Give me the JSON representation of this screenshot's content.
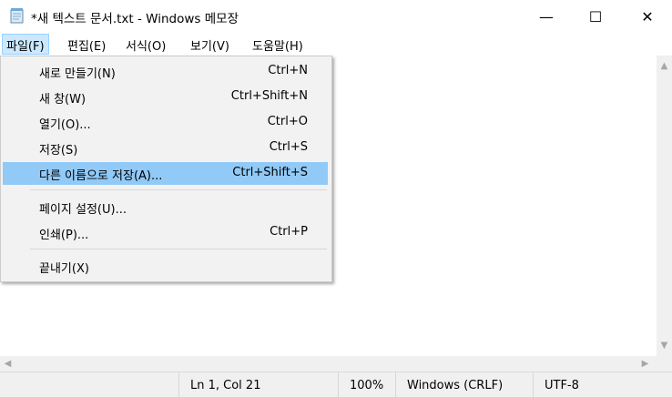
{
  "window": {
    "title": "*새 텍스트 문서.txt - Windows 메모장",
    "icon": "notepad-icon",
    "minimize_glyph": "—",
    "maximize_glyph": "☐",
    "close_glyph": "✕"
  },
  "menubar": {
    "items": [
      {
        "label": "파일(F)"
      },
      {
        "label": "편집(E)"
      },
      {
        "label": "서식(O)"
      },
      {
        "label": "보기(V)"
      },
      {
        "label": "도움말(H)"
      }
    ]
  },
  "file_menu": {
    "items": [
      {
        "label": "새로 만들기(N)",
        "shortcut": "Ctrl+N"
      },
      {
        "label": "새 창(W)",
        "shortcut": "Ctrl+Shift+N"
      },
      {
        "label": "열기(O)...",
        "shortcut": "Ctrl+O"
      },
      {
        "label": "저장(S)",
        "shortcut": "Ctrl+S"
      },
      {
        "label": "다른 이름으로 저장(A)...",
        "shortcut": "Ctrl+Shift+S"
      },
      {
        "label": "페이지 설정(U)...",
        "shortcut": ""
      },
      {
        "label": "인쇄(P)...",
        "shortcut": "Ctrl+P"
      },
      {
        "label": "끝내기(X)",
        "shortcut": ""
      }
    ],
    "highlighted_index": 4
  },
  "statusbar": {
    "position": "Ln 1, Col 21",
    "zoom": "100%",
    "line_ending": "Windows (CRLF)",
    "encoding": "UTF-8"
  },
  "colors": {
    "menu_highlight": "#91c9f7",
    "menubar_active": "#cce8ff"
  }
}
